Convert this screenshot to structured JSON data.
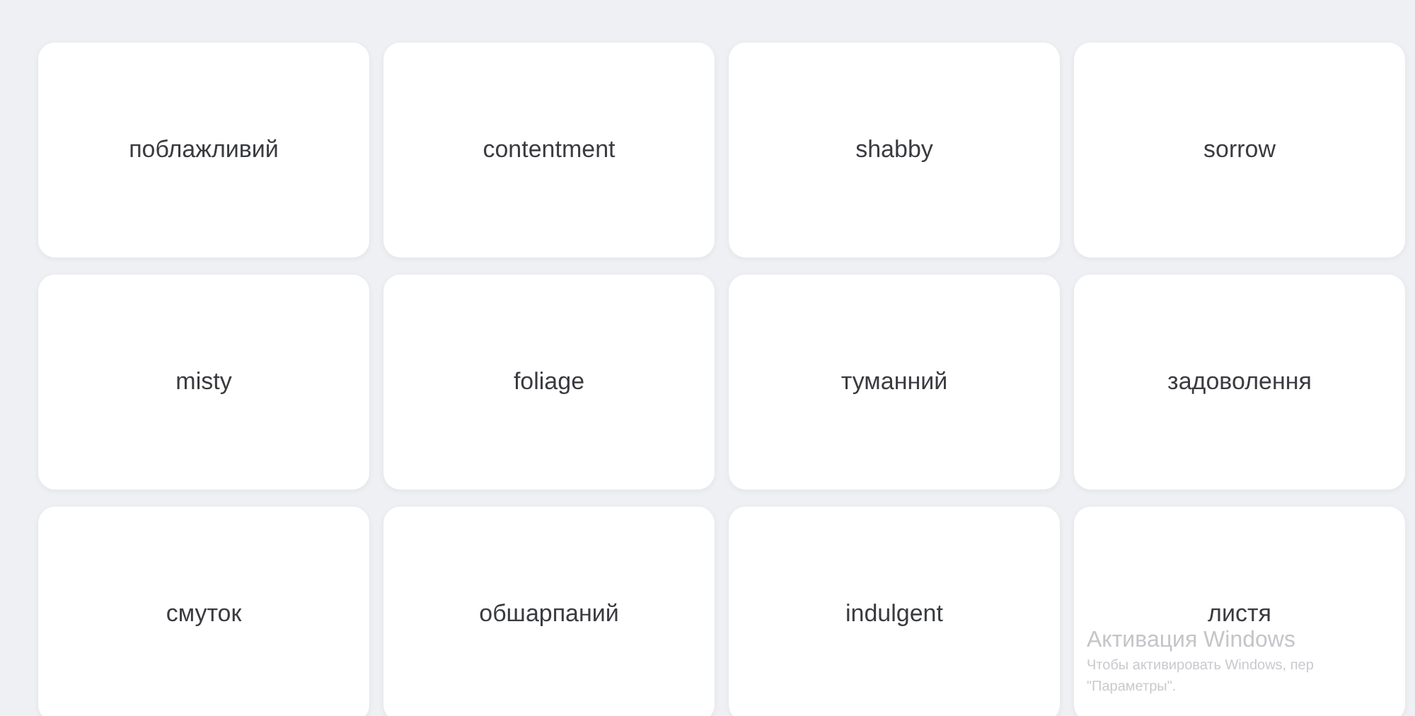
{
  "cards": [
    {
      "label": "поблажливий"
    },
    {
      "label": "contentment"
    },
    {
      "label": "shabby"
    },
    {
      "label": "sorrow"
    },
    {
      "label": "misty"
    },
    {
      "label": "foliage"
    },
    {
      "label": "туманний"
    },
    {
      "label": "задоволення"
    },
    {
      "label": "смуток"
    },
    {
      "label": "обшарпаний"
    },
    {
      "label": "indulgent"
    },
    {
      "label": "листя"
    }
  ],
  "activation_notice": {
    "title": "Активация Windows",
    "lines": [
      "Чтобы активировать Windows, пер",
      "\"Параметры\"."
    ]
  }
}
